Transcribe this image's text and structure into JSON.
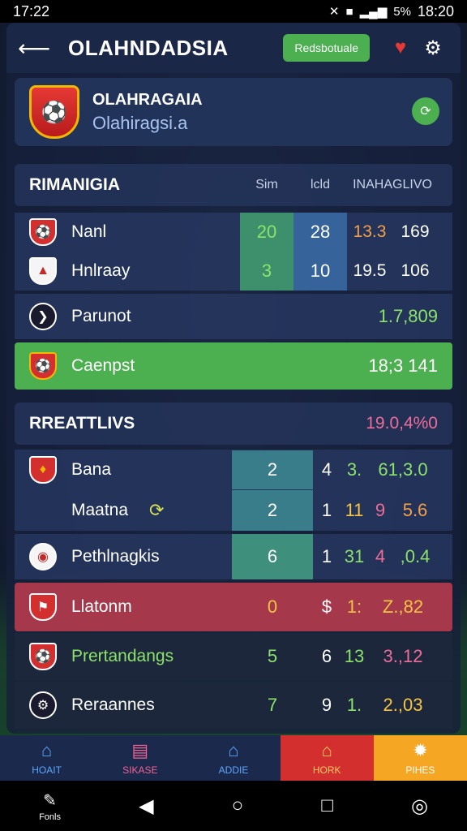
{
  "status": {
    "time_left": "17:22",
    "time_right": "18:20",
    "battery": "5%"
  },
  "header": {
    "title": "OLAHNDADSIA",
    "action_label": "Redsbotuale"
  },
  "team": {
    "name": "OLAHRAGAIA",
    "subtitle": "Olahiragsi.a"
  },
  "section1": {
    "title": "RIMANIGIA",
    "columns": [
      "Sim",
      "lcld",
      "INAHAGLIVO"
    ],
    "rows": [
      {
        "name": "Nanl",
        "v1": "20",
        "v2": "28",
        "v3a": "13.3",
        "v3b": "169"
      },
      {
        "name": "Hnlraay",
        "v1": "3",
        "v2": "10",
        "v3a": "19.5",
        "v3b": "106"
      }
    ],
    "single_row": {
      "name": "Parunot",
      "value": "1.7,809"
    },
    "highlight_row": {
      "name": "Caenpst",
      "value": "18;3 141"
    }
  },
  "section2": {
    "title": "RREATTLIVS",
    "value": "19.0,4%0",
    "rows": [
      {
        "name": "Bana",
        "v1": "2",
        "v2": "4",
        "v3": "3.",
        "v4": "61,3.0"
      },
      {
        "name": "Maatna",
        "v1": "2",
        "v2": "1",
        "v3": "11",
        "v4": "9",
        "v5": "5.6"
      },
      {
        "name": "Pethlnagkis",
        "v1": "6",
        "v2": "1",
        "v3": "31",
        "v4": "4",
        "v5": ",0.4"
      },
      {
        "name": "Llatonm",
        "v1": "0",
        "v2": "$",
        "v3": "1:",
        "v4": "Z.,82"
      },
      {
        "name": "Prertandangs",
        "v1": "5",
        "v2": "6",
        "v3": "13",
        "v4": "3.,12"
      },
      {
        "name": "Reraannes",
        "v1": "7",
        "v2": "9",
        "v3": "1.",
        "v4": "2.,03"
      }
    ]
  },
  "nav": {
    "items": [
      {
        "label": "HOAIT",
        "icon": "home-icon"
      },
      {
        "label": "SIKASE",
        "icon": "stats-icon"
      },
      {
        "label": "ADDIE",
        "icon": "house-icon"
      },
      {
        "label": "HORK",
        "icon": "store-icon"
      },
      {
        "label": "PIHES",
        "icon": "fire-icon"
      }
    ]
  },
  "system": {
    "left_label": "Fonls"
  }
}
